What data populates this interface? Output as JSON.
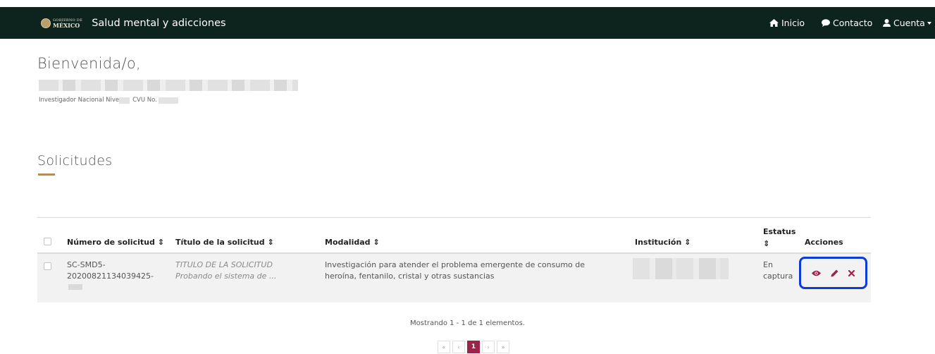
{
  "header": {
    "logo_line1": "GOBIERNO DE",
    "logo_line2": "MÉXICO",
    "title": "Salud mental y adicciones",
    "nav": {
      "inicio": "Inicio",
      "contacto": "Contacto",
      "cuenta": "Cuenta"
    }
  },
  "welcome": {
    "greeting": "Bienvenida/o,",
    "researcher_prefix": "Investigador Nacional Nive",
    "cvu_prefix": "CVU No."
  },
  "section": {
    "title": "Solicitudes"
  },
  "table": {
    "columns": {
      "numero": "Número de solicitud",
      "titulo": "Título de la solicitud",
      "modalidad": "Modalidad",
      "institucion": "Institución",
      "estatus": "Estatus",
      "acciones": "Acciones"
    },
    "sort_glyph": "⇕",
    "rows": [
      {
        "numero_l1": "SC-SMD5-",
        "numero_l2": "20200821134039425-",
        "titulo_l1": "TITULO DE LA SOLICITUD",
        "titulo_l2": "Probando el sistema de ...",
        "modalidad_l1": "Investigación para atender el problema emergente de consumo de",
        "modalidad_l2": "heroína, fentanilo, cristal y otras sustancias",
        "estatus_l1": "En",
        "estatus_l2": "captura"
      }
    ]
  },
  "footer": {
    "summary": "Mostrando 1 - 1 de 1 elementos.",
    "pagination": {
      "first": "«",
      "prev": "‹",
      "current": "1",
      "next": "›",
      "last": "»"
    }
  },
  "colors": {
    "navbar": "#0c231e",
    "accent_gold": "#b38e5d",
    "action_red": "#9d2449",
    "highlight_blue": "#0b3bd8"
  },
  "icons": [
    "home-icon",
    "comment-icon",
    "user-icon",
    "eye-icon",
    "pencil-icon",
    "close-icon"
  ]
}
